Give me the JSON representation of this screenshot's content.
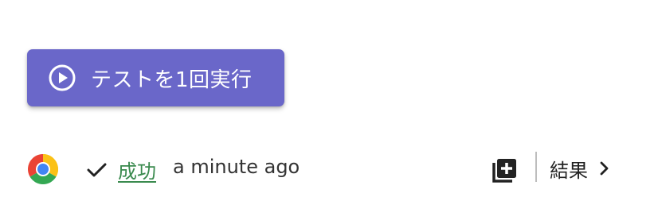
{
  "run_button": {
    "label": "テストを1回実行",
    "icon": "play-circle-icon",
    "color": "#6a67c9"
  },
  "result": {
    "browser_icon": "chrome-icon",
    "status_icon": "check-icon",
    "status_label": "成功",
    "status_color": "#3a8a4e",
    "timestamp": "a minute ago",
    "add_icon": "library-add-icon",
    "results_label": "結果",
    "results_icon": "chevron-right-icon"
  }
}
